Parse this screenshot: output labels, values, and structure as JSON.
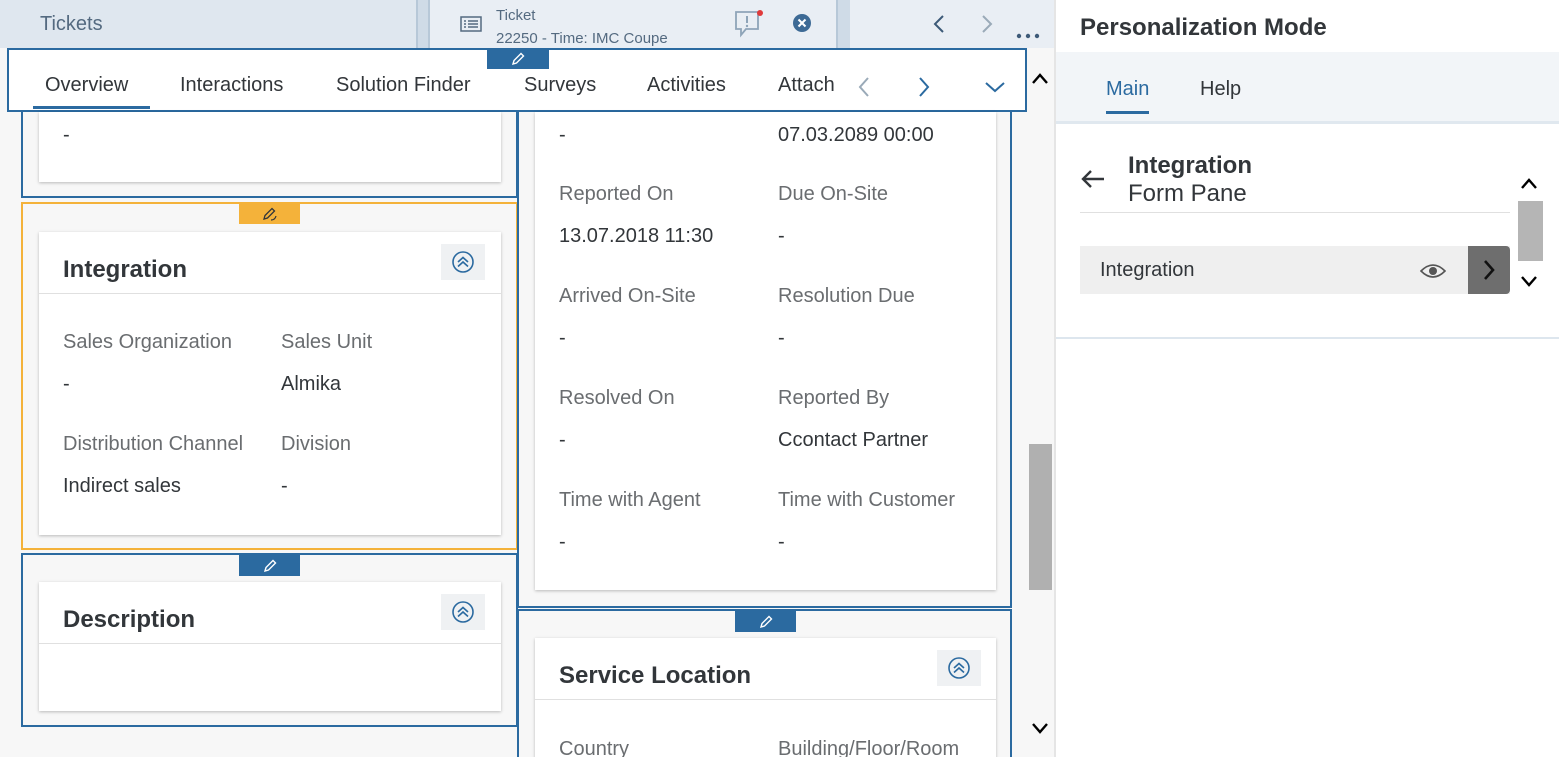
{
  "top_strip": {
    "tickets_tab": "Tickets",
    "ticket_tab": {
      "line1": "Ticket",
      "line2": "22250 - Time: IMC Coupe"
    },
    "icons": {
      "ticket": "list-icon",
      "alert": "alert-bubble-icon",
      "close": "close-circle-icon",
      "prev": "chevron-left-icon",
      "next": "chevron-right-icon",
      "more": "more-icon"
    }
  },
  "subtabs": [
    "Overview",
    "Interactions",
    "Solution Finder",
    "Surveys",
    "Activities",
    "Attach"
  ],
  "general_card_top": {
    "value": "-"
  },
  "integration": {
    "title": "Integration",
    "fields": [
      {
        "label": "Sales Organization",
        "value": "-"
      },
      {
        "label": "Sales Unit",
        "value": "Almika"
      },
      {
        "label": "Distribution Channel",
        "value": "Indirect sales"
      },
      {
        "label": "Division",
        "value": "-"
      }
    ]
  },
  "description": {
    "title": "Description"
  },
  "dates": {
    "top_values": [
      "-",
      "07.03.2089 00:00"
    ],
    "fields": [
      {
        "label": "Reported On",
        "value": "13.07.2018 11:30"
      },
      {
        "label": "Due On-Site",
        "value": "-"
      },
      {
        "label": "Arrived On-Site",
        "value": "-"
      },
      {
        "label": "Resolution Due",
        "value": "-"
      },
      {
        "label": "Resolved On",
        "value": "-"
      },
      {
        "label": "Reported By",
        "value": "Ccontact Partner"
      },
      {
        "label": "Time with Agent",
        "value": "-"
      },
      {
        "label": "Time with Customer",
        "value": "-"
      }
    ]
  },
  "service_location": {
    "title": "Service Location",
    "labels": [
      "Country",
      "Building/Floor/Room"
    ]
  },
  "panel": {
    "title": "Personalization Mode",
    "tabs": [
      "Main",
      "Help"
    ],
    "heading": "Integration",
    "subheading": "Form Pane",
    "row_label": "Integration"
  },
  "colors": {
    "accent": "#2b6aa0",
    "highlight": "#f4b23a"
  }
}
